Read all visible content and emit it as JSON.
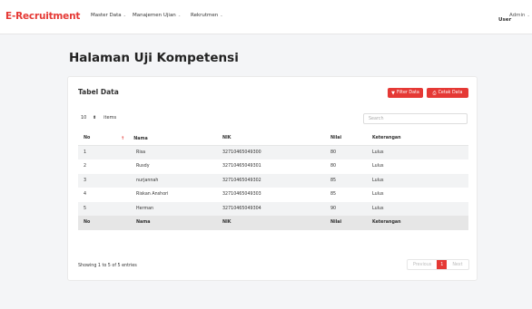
{
  "nav": {
    "brand": "E-Recruitment",
    "menu": [
      {
        "label": "Master Data"
      },
      {
        "label": "Manajemen Ujian"
      },
      {
        "label": "Rekrutmen"
      }
    ],
    "user_role": "Admin",
    "user_name": "User"
  },
  "page": {
    "title": "Halaman Uji Kompetensi"
  },
  "card": {
    "title": "Tabel Data",
    "filter_label": "Filter Data",
    "print_label": "Cetak Data",
    "length_value": "10",
    "length_suffix": "items",
    "search_placeholder": "Search",
    "columns": [
      "No",
      "Nama",
      "NIK",
      "Nilai",
      "Keterangan"
    ],
    "rows": [
      {
        "no": "1",
        "nama": "Risa",
        "nik": "32710465049300",
        "nilai": "80",
        "ket": "Lulus"
      },
      {
        "no": "2",
        "nama": "Rusdy",
        "nik": "32710465049301",
        "nilai": "80",
        "ket": "Lulus"
      },
      {
        "no": "3",
        "nama": "nurjannah",
        "nik": "32710465049302",
        "nilai": "85",
        "ket": "Lulus"
      },
      {
        "no": "4",
        "nama": "Riskan Anshori",
        "nik": "32710465049303",
        "nilai": "85",
        "ket": "Lulus"
      },
      {
        "no": "5",
        "nama": "Herman",
        "nik": "32710465049304",
        "nilai": "90",
        "ket": "Lulus"
      }
    ],
    "info": "Showing 1 to 5 of 5 entries",
    "pager": {
      "previous": "Previous",
      "current": "1",
      "next": "Next"
    }
  },
  "colors": {
    "accent": "#e53935"
  }
}
